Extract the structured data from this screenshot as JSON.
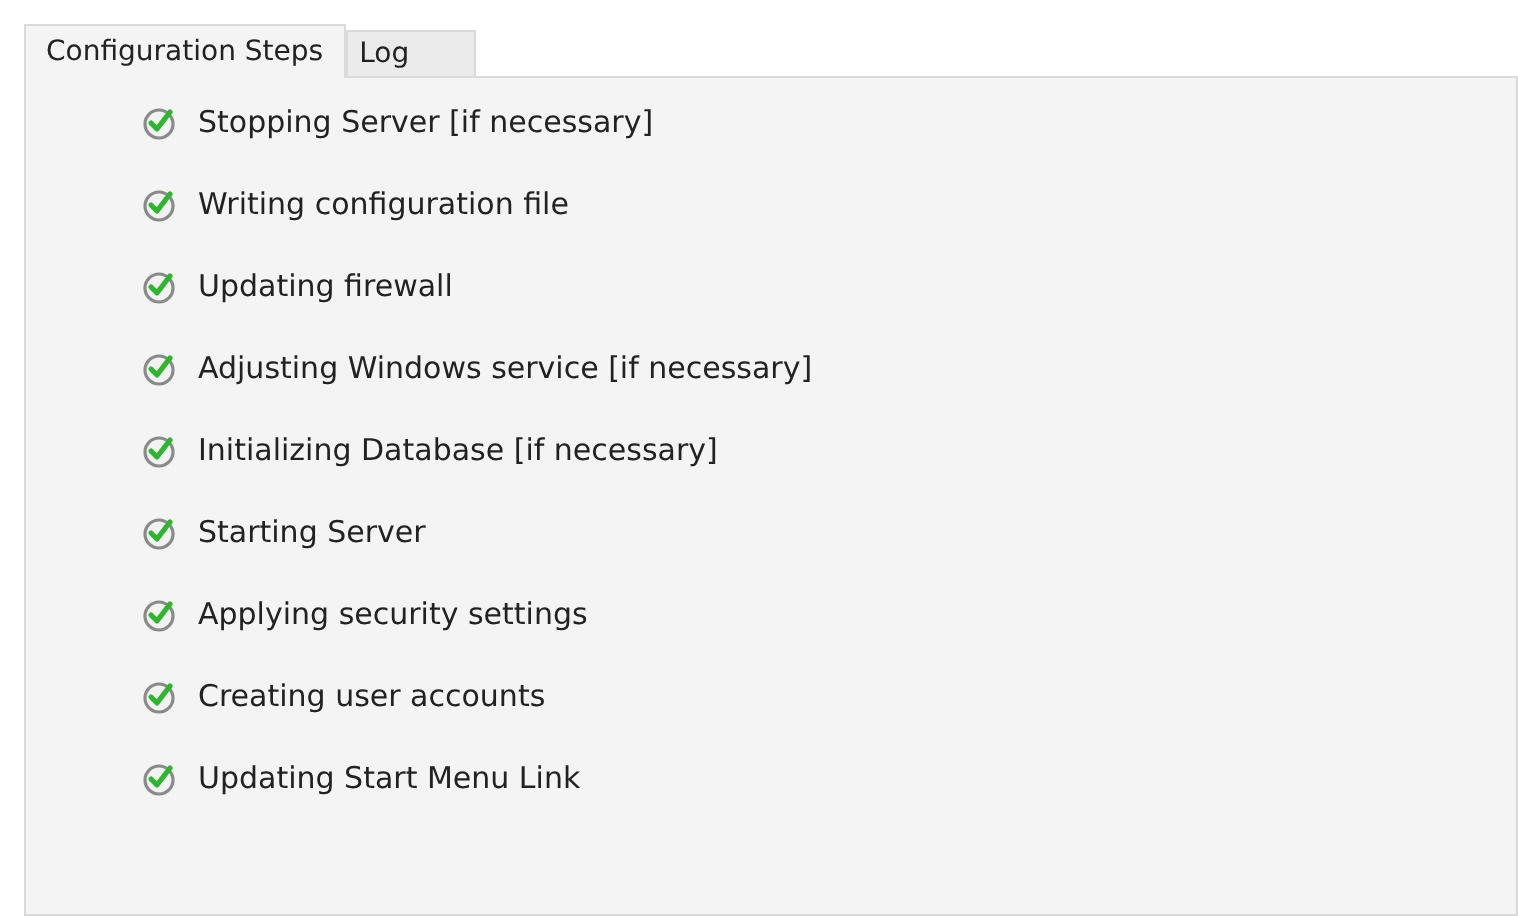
{
  "tabs": [
    {
      "label": "Configuration Steps",
      "selected": true
    },
    {
      "label": "Log",
      "selected": false
    }
  ],
  "steps": [
    {
      "label": "Stopping Server [if necessary]",
      "done": true
    },
    {
      "label": "Writing configuration file",
      "done": true
    },
    {
      "label": "Updating firewall",
      "done": true
    },
    {
      "label": "Adjusting Windows service [if necessary]",
      "done": true
    },
    {
      "label": "Initializing Database [if necessary]",
      "done": true
    },
    {
      "label": "Starting Server",
      "done": true
    },
    {
      "label": "Applying security settings",
      "done": true
    },
    {
      "label": "Creating user accounts",
      "done": true
    },
    {
      "label": "Updating Start Menu Link",
      "done": true
    }
  ]
}
